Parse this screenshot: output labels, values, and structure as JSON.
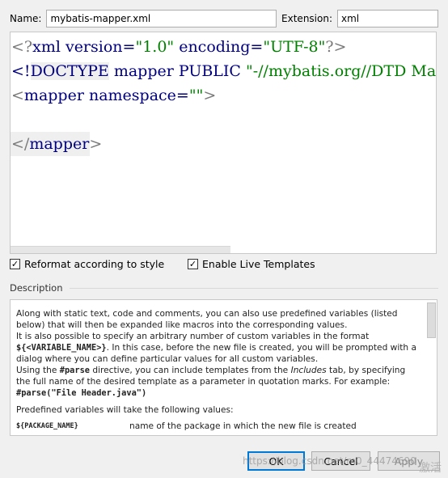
{
  "name_field": {
    "label": "Name:",
    "value": "mybatis-mapper.xml"
  },
  "extension_field": {
    "label": "Extension:",
    "value": "xml"
  },
  "editor": {
    "line1": {
      "open": "<?",
      "keyword": "xml version=",
      "v1": "\"1.0\"",
      "attr2": " encoding=",
      "v2": "\"UTF-8\"",
      "close": "?>"
    },
    "line2": {
      "open": "<!",
      "doctype": "DOCTYPE",
      "mapper": " mapper",
      "public": " PUBLIC",
      "string": " \"-//mybatis.org//DTD Map"
    },
    "line3": {
      "open": "<",
      "tag": "mapper",
      "attr": " namespace=",
      "value": "\"\"",
      "close": ">"
    },
    "line5": {
      "open": "</",
      "tag": "mapper",
      "close": ">"
    }
  },
  "options": {
    "reformat": {
      "label": "Reformat according to style",
      "checked": true
    },
    "live_templates": {
      "label": "Enable Live Templates",
      "checked": true
    }
  },
  "description": {
    "heading": "Description",
    "p1": "Along with static text, code and comments, you can also use predefined variables (listed below) that will then be expanded like macros into the corresponding values.",
    "p2a": "It is also possible to specify an arbitrary number of custom variables in the format ",
    "p2_code": "${<VARIABLE_NAME>}",
    "p2b": ". In this case, before the new file is created, you will be prompted with a dialog where you can define particular values for all custom variables.",
    "p3a": "Using the ",
    "p3_code": "#parse",
    "p3b": " directive, you can include templates from the ",
    "p3_italic": "Includes",
    "p3c": " tab, by specifying the full name of the desired template as a parameter in quotation marks. For example:",
    "p3_example": "#parse(\"File Header.java\")",
    "p4": "Predefined variables will take the following values:",
    "var1_name": "${PACKAGE_NAME}",
    "var1_desc": "name of the package in which the new file is created"
  },
  "buttons": {
    "ok": "OK",
    "cancel": "Cancel",
    "apply": "Apply"
  },
  "watermark": {
    "text": "https://blog.csdn.net/m0_44474690",
    "corner": "激活"
  }
}
